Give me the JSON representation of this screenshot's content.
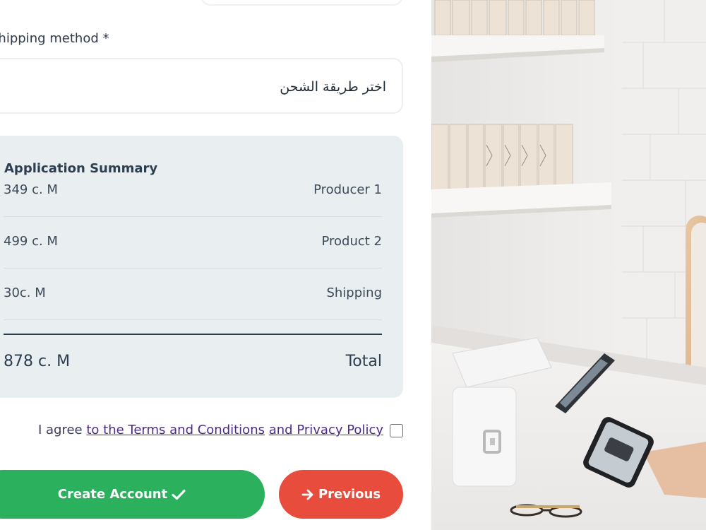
{
  "shipping": {
    "label": "Shipping method *",
    "selected_value": "اختر طريقة الشحن"
  },
  "summary": {
    "title": "Application Summary",
    "items": [
      {
        "price": "349 c. M",
        "name": "Producer 1"
      },
      {
        "price": "499 c. M",
        "name": "Product 2"
      },
      {
        "price": "30c. M",
        "name": "Shipping"
      }
    ],
    "total": {
      "price": "878 c. M",
      "name": "Total"
    }
  },
  "agreement": {
    "prefix": "I agree ",
    "terms_link": "to the Terms and Conditions",
    "privacy_link": "and Privacy Policy",
    "checked": false
  },
  "buttons": {
    "create_label": "Create Account",
    "previous_label": "Previous"
  },
  "icons": {
    "create": "check-icon",
    "previous": "arrow-right-icon",
    "terminal_logo": "square-logo-icon"
  },
  "colors": {
    "create_button": "#2bb05d",
    "previous_button": "#e74c3c",
    "summary_background": "#e9eef0",
    "link": "#4b2a8a"
  }
}
